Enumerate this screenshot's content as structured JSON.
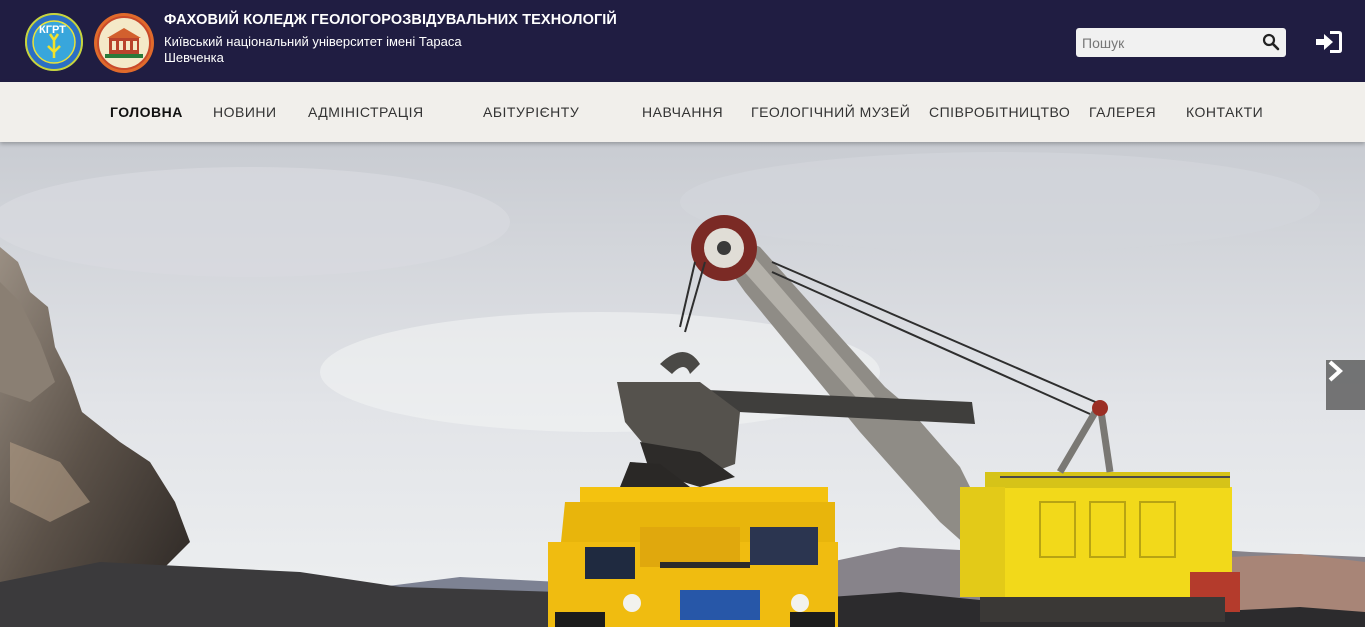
{
  "header": {
    "college_name": "ФАХОВИЙ КОЛЕДЖ ГЕОЛОГОРОЗВІДУВАЛЬНИХ ТЕХНОЛОГІЙ",
    "university_name": "Київський національний університет імені Тараса Шевченка",
    "logo_text": "КГРТ",
    "search": {
      "placeholder": "Пошук"
    },
    "icons": {
      "search": "search-icon",
      "login": "sign-in-icon"
    }
  },
  "nav": {
    "items": [
      {
        "label": "ГОЛОВНА",
        "active": true
      },
      {
        "label": "НОВИНИ",
        "active": false
      },
      {
        "label": "АДМІНІСТРАЦІЯ",
        "active": false
      },
      {
        "label": "АБІТУРІЄНТУ",
        "active": false
      },
      {
        "label": "НАВЧАННЯ",
        "active": false
      },
      {
        "label": "ГЕОЛОГІЧНИЙ МУЗЕЙ",
        "active": false
      },
      {
        "label": "СПІВРОБІТНИЦТВО",
        "active": false
      },
      {
        "label": "ГАЛЕРЕЯ",
        "active": false
      },
      {
        "label": "КОНТАКТИ",
        "active": false
      }
    ]
  },
  "hero": {
    "slider_next_icon": "chevron-right-icon"
  },
  "colors": {
    "header_bg": "#201d42",
    "nav_bg": "#f1efeb",
    "machine_yellow": "#f2d91a"
  }
}
